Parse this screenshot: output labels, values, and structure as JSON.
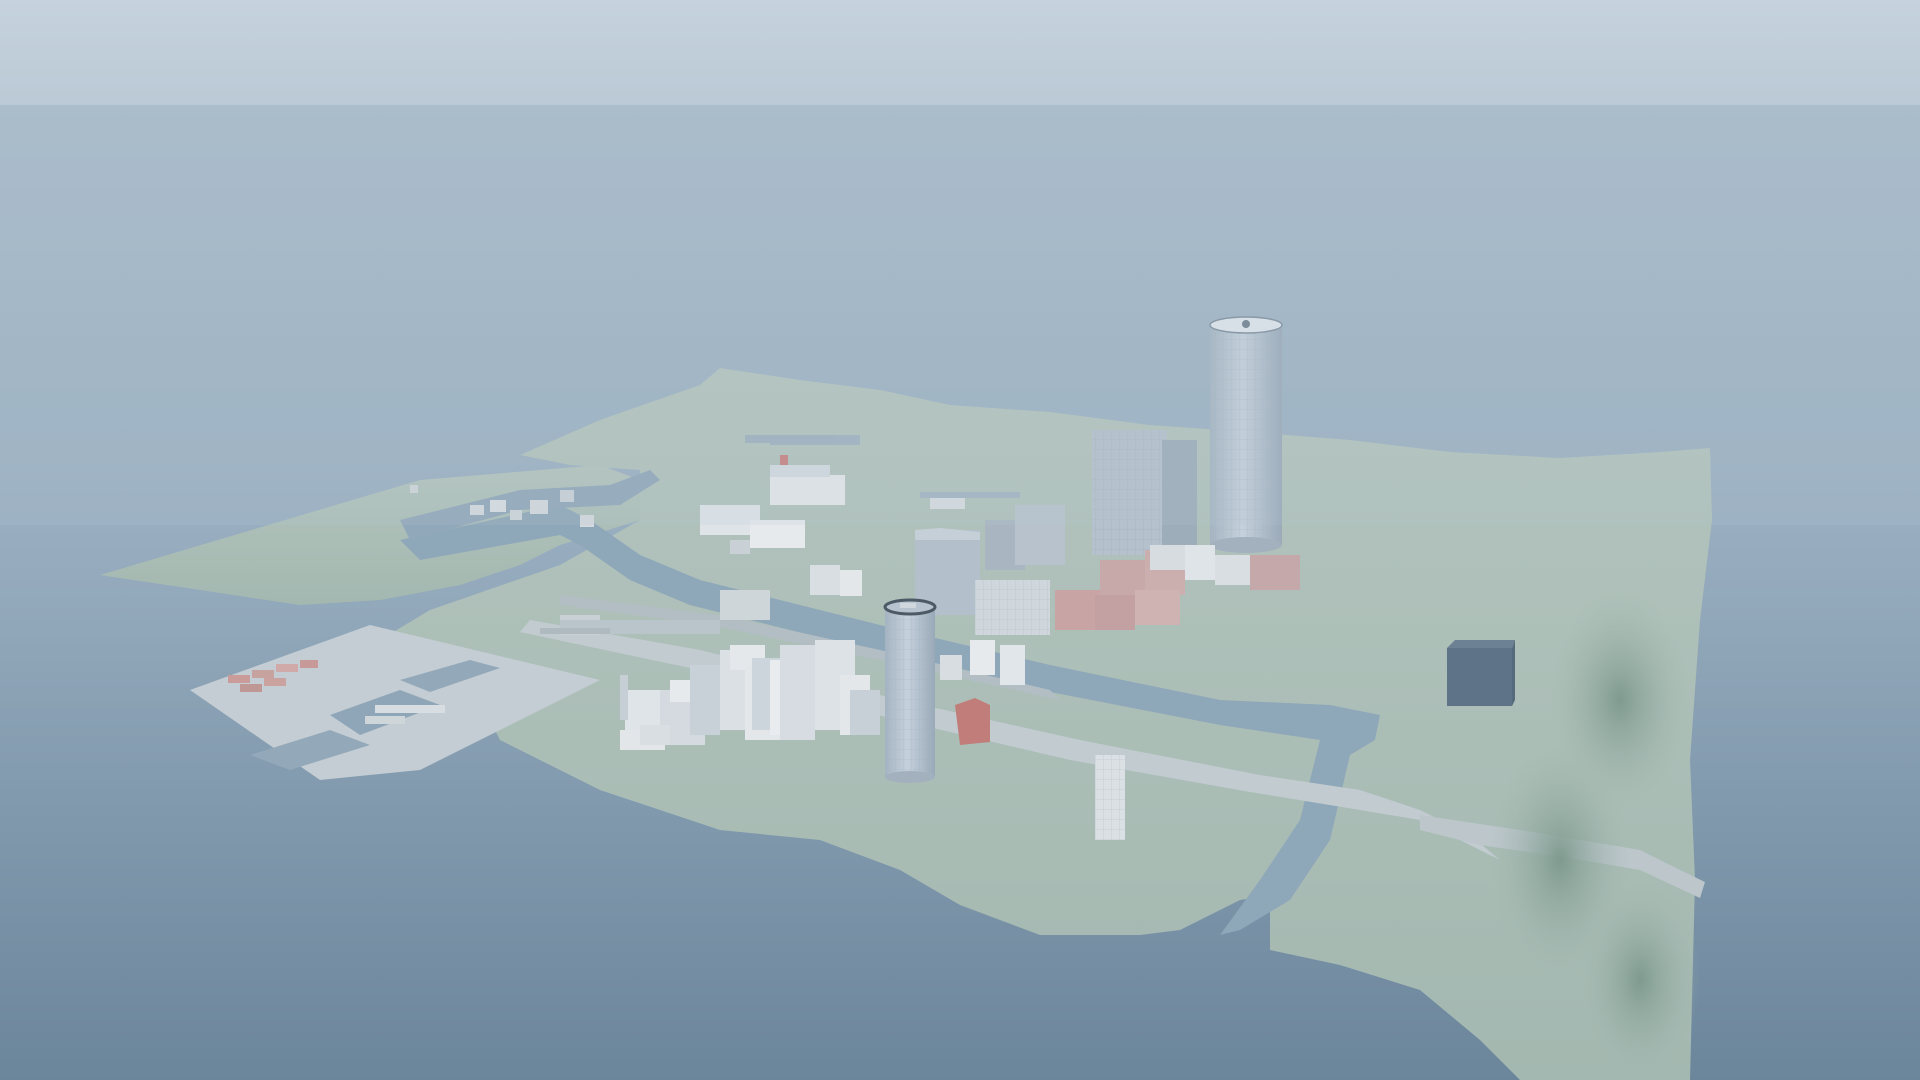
{
  "scene": {
    "kind": "3d-city-island-render",
    "hud_text": [],
    "colors": {
      "sky_top": "#c4d2de",
      "sky_bottom": "#bccbd7",
      "sea_far": "#a6b8c8",
      "sea_near": "#6f899f",
      "land": "#a9bdb5",
      "land_shadow": "#99afa8",
      "water_channel": "#8ea6b8",
      "road": "#b9c4c9",
      "pavement": "#c9d2d6",
      "building_light": "#d9dee2",
      "building_mid": "#b9c3cc",
      "building_dark": "#8e9fae",
      "building_red": "#c9a4a4",
      "tower": "#b6c3d0",
      "cube": "#5f7488"
    },
    "objects": [
      {
        "name": "main-island",
        "type": "terrain"
      },
      {
        "name": "west-peninsula",
        "type": "terrain"
      },
      {
        "name": "harbor-piers",
        "type": "pavement"
      },
      {
        "name": "canal",
        "type": "water"
      },
      {
        "name": "highway",
        "type": "road"
      },
      {
        "name": "tall-cylindrical-tower",
        "type": "building"
      },
      {
        "name": "short-cylindrical-tower",
        "type": "building"
      },
      {
        "name": "downtown-cluster",
        "type": "building-group"
      },
      {
        "name": "northwest-blocks",
        "type": "building-group"
      },
      {
        "name": "dark-cube",
        "type": "building"
      },
      {
        "name": "harbor-containers",
        "type": "prop-group"
      },
      {
        "name": "forest-patch",
        "type": "vegetation"
      }
    ]
  }
}
